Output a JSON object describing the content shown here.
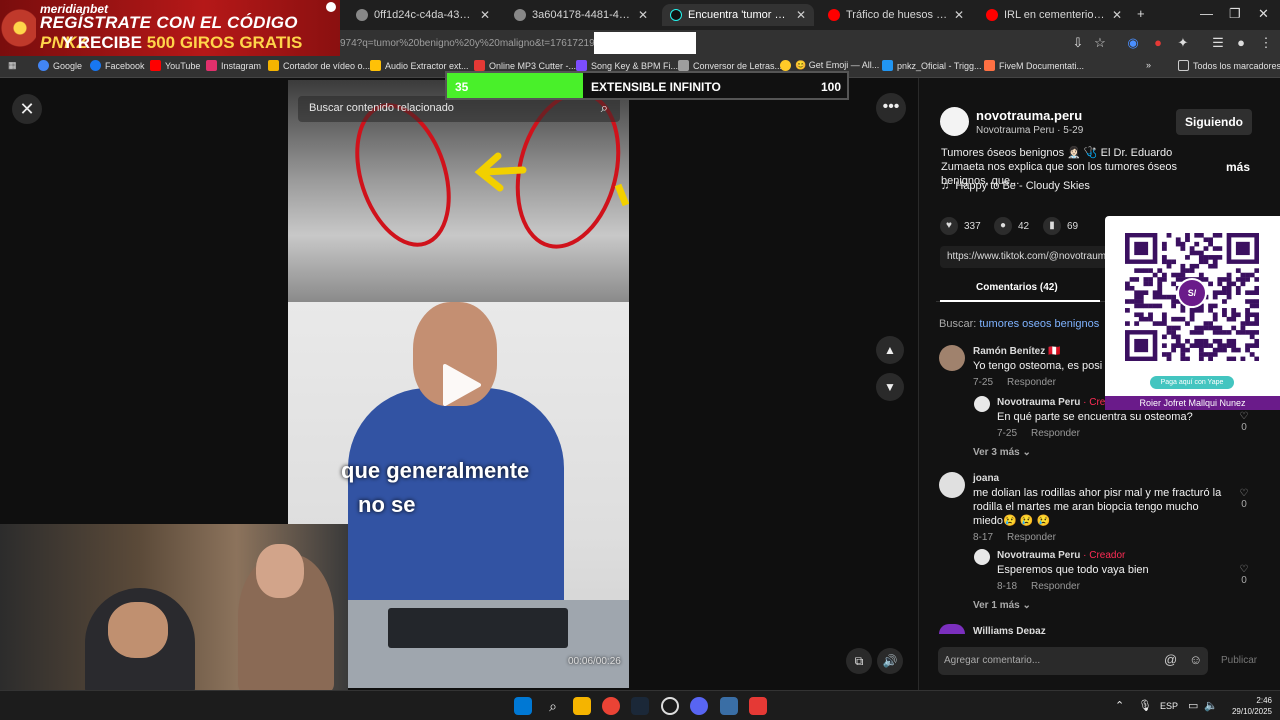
{
  "ad": {
    "brand": "meridianbet",
    "line1": "REGÍSTRATE CON EL CÓDIGO",
    "code": "PNKZ",
    "line2_pre": "Y RECIBE",
    "line2_bold": "500 GIROS GRATIS"
  },
  "tabs": [
    {
      "label": "0ff1d24c-c4da-43a4-8430-ba7",
      "active": false
    },
    {
      "label": "3a604178-4481-49ca-9b30-a0",
      "active": false
    },
    {
      "label": "Encuentra 'tumor benigno y m",
      "active": true
    },
    {
      "label": "Tráfico de huesos y restos hum",
      "active": false
    },
    {
      "label": "IRL en cementerio preinca | Sh",
      "active": false
    }
  ],
  "address": {
    "url": "974?q=tumor%20benigno%20y%20maligno&t=1761721925976"
  },
  "bookmarks": [
    {
      "label": "Google",
      "color": "#4285f4"
    },
    {
      "label": "Facebook",
      "color": "#1877f2"
    },
    {
      "label": "YouTube",
      "color": "#ff0000"
    },
    {
      "label": "Instagram",
      "color": "#e1306c"
    },
    {
      "label": "Cortador de vídeo o...",
      "color": "#f5b400"
    },
    {
      "label": "Audio Extractor ext...",
      "color": "#ffc107"
    },
    {
      "label": "Online MP3 Cutter -...",
      "color": "#e53935"
    },
    {
      "label": "Song Key & BPM Fi...",
      "color": "#7c4dff"
    },
    {
      "label": "Conversor de Letras...",
      "color": "#9e9e9e"
    },
    {
      "label": "😊 Get Emoji — All...",
      "color": "#ffca28"
    },
    {
      "label": "pnkz_Oficial - Trigg...",
      "color": "#2196f3"
    },
    {
      "label": "FiveM Documentati...",
      "color": "#ff7043"
    }
  ],
  "bookmarks_all": "Todos los marcadores",
  "progress": {
    "current": "35",
    "label": "EXTENSIBLE INFINITO",
    "max": "100",
    "fraction": 0.34
  },
  "video": {
    "search_placeholder": "Buscar contenido relacionado",
    "caption_line1": "que generalmente",
    "caption_line2": "no se",
    "time": "00:06/00:26"
  },
  "profile": {
    "name": "novotrauma.peru",
    "sub": "Novotrauma Peru · 5-29",
    "follow": "Siguiendo",
    "description": "Tumores óseos benignos 👩🏻‍⚕️ 🩺 El Dr. Eduardo Zumaeta nos explica que son los tumores óseos benignos, que...",
    "more": "más",
    "music": "Happy to Be - Cloudy Skies",
    "likes": "337",
    "comments": "42",
    "saves": "69",
    "link": "https://www.tiktok.com/@novotrauma"
  },
  "comments_tab": "Comentarios (42)",
  "search": {
    "prefix": "Buscar:",
    "term": "tumores oseos benignos"
  },
  "comments": [
    {
      "name": "Ramón Benítez 🇵🇪",
      "text": "Yo tengo osteoma, es posi",
      "date": "7-25",
      "reply": "Responder"
    },
    {
      "name": "Novotrauma Peru",
      "tag": "· Creador",
      "text": "En qué parte se encuentra su osteoma?",
      "date": "7-25",
      "reply": "Responder",
      "likes": "0"
    },
    {
      "more": "Ver 3 más"
    },
    {
      "name": "joana",
      "text1": "me dolian las rodillas ahor pisr mal y me fracturó la",
      "text2": "rodilla el martes me aran biopcia tengo mucho",
      "text3": "miedo😢 😢 😢",
      "date": "8-17",
      "reply": "Responder",
      "likes": "0"
    },
    {
      "name": "Novotrauma Peru",
      "tag": "· Creador",
      "text": "Esperemos que todo vaya bien",
      "date": "8-18",
      "reply": "Responder",
      "likes": "0"
    },
    {
      "more": "Ver 1 más"
    },
    {
      "name": "Williams Depaz"
    }
  ],
  "qr": {
    "pay": "Paga aquí con Yape",
    "name": "Roier Jofret Mallqui Nunez"
  },
  "input": {
    "placeholder": "Agregar comentario...",
    "publish": "Publicar"
  },
  "tray": {
    "lang": "ESP",
    "time": "2:46",
    "date": "29/10/2025"
  }
}
